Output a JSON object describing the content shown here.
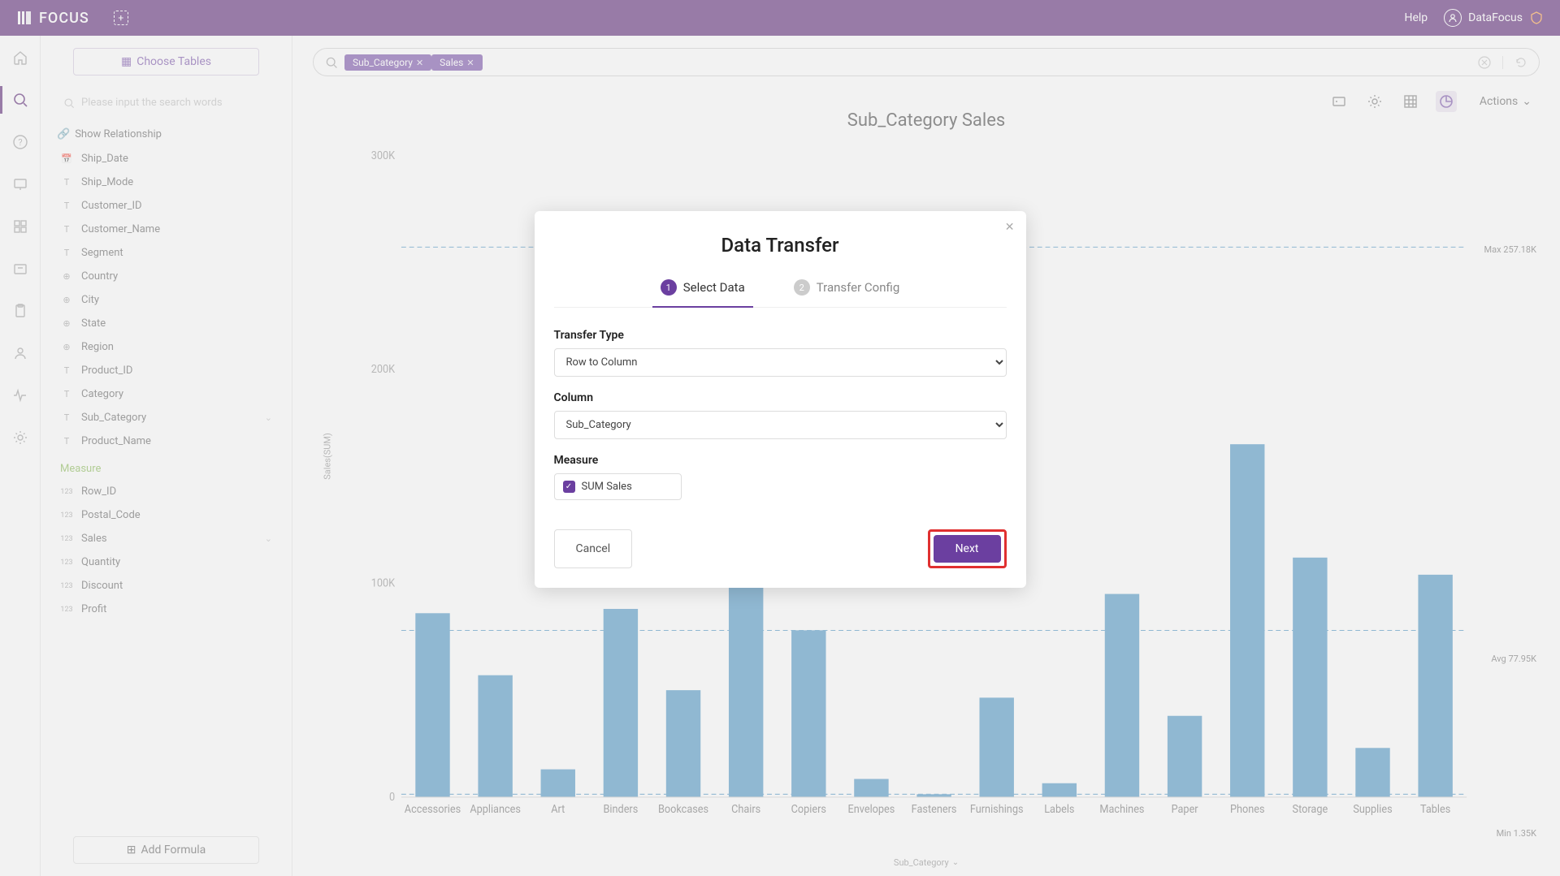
{
  "brand": "FOCUS",
  "help_label": "Help",
  "user_name": "DataFocus",
  "choose_tables_label": "Choose Tables",
  "search_placeholder": "Please input the search words",
  "show_relationship_label": "Show Relationship",
  "fields": [
    {
      "icon": "date",
      "label": "Ship_Date"
    },
    {
      "icon": "T",
      "label": "Ship_Mode"
    },
    {
      "icon": "T",
      "label": "Customer_ID"
    },
    {
      "icon": "T",
      "label": "Customer_Name"
    },
    {
      "icon": "T",
      "label": "Segment"
    },
    {
      "icon": "globe",
      "label": "Country"
    },
    {
      "icon": "globe",
      "label": "City"
    },
    {
      "icon": "globe",
      "label": "State"
    },
    {
      "icon": "globe",
      "label": "Region"
    },
    {
      "icon": "T",
      "label": "Product_ID"
    },
    {
      "icon": "T",
      "label": "Category"
    },
    {
      "icon": "T",
      "label": "Sub_Category",
      "chev": true
    },
    {
      "icon": "T",
      "label": "Product_Name"
    }
  ],
  "measure_header": "Measure",
  "measures": [
    {
      "icon": "123",
      "label": "Row_ID"
    },
    {
      "icon": "123",
      "label": "Postal_Code"
    },
    {
      "icon": "123",
      "label": "Sales",
      "chev": true
    },
    {
      "icon": "123",
      "label": "Quantity"
    },
    {
      "icon": "123",
      "label": "Discount"
    },
    {
      "icon": "123",
      "label": "Profit"
    }
  ],
  "add_formula_label": "Add Formula",
  "query_pills": [
    "Sub_Category",
    "Sales"
  ],
  "actions_label": "Actions",
  "chart_title": "Sub_Category Sales",
  "yaxis_label": "Sales(SUM)",
  "xaxis_label": "Sub_Category",
  "ref_max": "Max 257.18K",
  "ref_avg": "Avg 77.95K",
  "ref_min": "Min 1.35K",
  "chart_data": {
    "type": "bar",
    "title": "Sub_Category Sales",
    "xlabel": "Sub_Category",
    "ylabel": "Sales(SUM)",
    "ylim": [
      0,
      300000
    ],
    "yticks": [
      "0",
      "100K",
      "200K",
      "300K"
    ],
    "categories": [
      "Accessories",
      "Appliances",
      "Art",
      "Binders",
      "Bookcases",
      "Chairs",
      "Copiers",
      "Envelopes",
      "Fasteners",
      "Furnishings",
      "Labels",
      "Machines",
      "Paper",
      "Phones",
      "Storage",
      "Supplies",
      "Tables"
    ],
    "values": [
      86000,
      57000,
      13000,
      88000,
      50000,
      170000,
      78000,
      8500,
      1350,
      46500,
      6500,
      95000,
      38000,
      165000,
      112000,
      23000,
      104000
    ],
    "reference_lines": [
      {
        "label": "Max 257.18K",
        "value": 257180
      },
      {
        "label": "Avg 77.95K",
        "value": 77950
      },
      {
        "label": "Min 1.35K",
        "value": 1350
      }
    ]
  },
  "modal": {
    "title": "Data Transfer",
    "step1": "Select Data",
    "step2": "Transfer Config",
    "transfer_type_label": "Transfer Type",
    "transfer_type_value": "Row to Column",
    "column_label": "Column",
    "column_value": "Sub_Category",
    "measure_label": "Measure",
    "measure_item": "SUM Sales",
    "cancel": "Cancel",
    "next": "Next"
  }
}
